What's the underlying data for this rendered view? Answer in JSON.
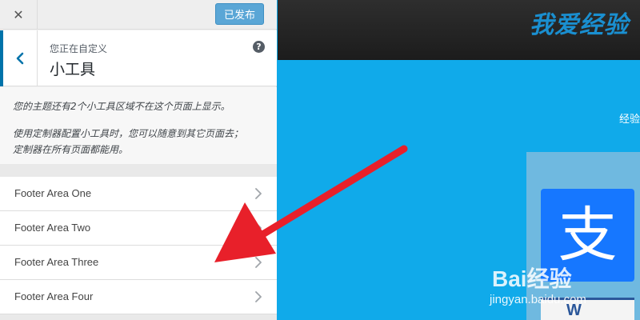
{
  "sidebar": {
    "close_glyph": "✕",
    "publish_label": "已发布",
    "customizing_label": "您正在自定义",
    "panel_title": "小工具",
    "help_glyph": "?",
    "notice_1": "您的主题还有2个小工具区域不在这个页面上显示。",
    "notice_2_line_1": "使用定制器配置小工具时，您可以随意到其它页面去；",
    "notice_2_line_2": "定制器在所有页面都能用。",
    "sections": [
      {
        "label": "Footer Area One"
      },
      {
        "label": "Footer Area Two"
      },
      {
        "label": "Footer Area Three"
      },
      {
        "label": "Footer Area Four"
      }
    ]
  },
  "preview": {
    "site_title": "我爱经验",
    "nav_text": "经验",
    "alipay_glyph": "支",
    "word_glyph": "W"
  },
  "watermark": {
    "logo": "Bai经验",
    "url": "jingyan.baidu.com"
  },
  "colors": {
    "accent": "#0073aa",
    "publish": "#5aa6d6",
    "preview_bg": "#10aaea",
    "arrow": "#e8202a"
  },
  "icons": [
    "close-icon",
    "chevron-left-icon",
    "help-icon",
    "chevron-right-icon",
    "red-arrow-annotation"
  ]
}
